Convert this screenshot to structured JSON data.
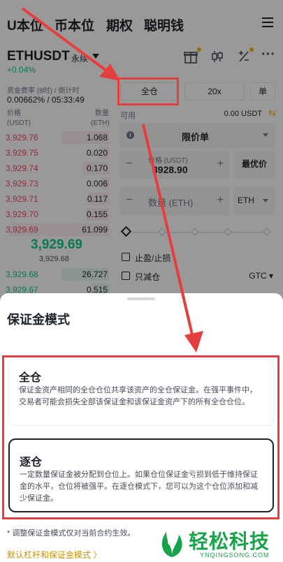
{
  "nav": {
    "tabs": [
      "U本位",
      "币本位",
      "期权",
      "聪明钱"
    ]
  },
  "header": {
    "symbol": "ETHUSDT",
    "type_tag": "永续",
    "change": "+0.04%",
    "funding_label": "资金费率 (8时) / 倒计时",
    "funding_value": "0.00662% / 05:33:49"
  },
  "orderbook": {
    "price_label": "价格",
    "price_unit": "(USDT)",
    "qty_label": "数量",
    "qty_unit": "(ETH)",
    "asks": [
      {
        "price": "3,929.76",
        "qty": "1.068",
        "depth": 0.45
      },
      {
        "price": "3,929.75",
        "qty": "0.020",
        "depth": 0.1
      },
      {
        "price": "3,929.74",
        "qty": "0.170",
        "depth": 0.25
      },
      {
        "price": "3,929.73",
        "qty": "0.006",
        "depth": 0.08
      },
      {
        "price": "3,929.71",
        "qty": "0.117",
        "depth": 0.2
      },
      {
        "price": "3,929.70",
        "qty": "0.155",
        "depth": 0.22
      },
      {
        "price": "3,929.69",
        "qty": "61.099",
        "depth": 0.95
      }
    ],
    "last_price": "3,929.69",
    "mark_price": "3,929.68",
    "bids": [
      {
        "price": "3,929.68",
        "qty": "26.727",
        "depth": 0.45
      },
      {
        "price": "3,929.67",
        "qty": "0.515",
        "depth": 0.15
      }
    ]
  },
  "order_form": {
    "margin_mode": "全仓",
    "leverage": "20x",
    "single_button": "单",
    "available_label": "可用",
    "available_value": "0.00 USDT",
    "order_type": "限价单",
    "price_label": "价格 (USDT)",
    "price_value": "3928.90",
    "best_price": "最优价",
    "qty_placeholder": "数量 (ETH)",
    "qty_unit": "ETH",
    "tp_sl": "止盈/止损",
    "reduce_only": "只减仓",
    "tif": "GTC"
  },
  "sheet": {
    "title": "保证金模式",
    "cross": {
      "title": "全仓",
      "desc": "保证金资产相同的全仓仓位共享该资产的全仓保证金。在强平事件中，交易者可能会损失全部该保证金和该保证金资产下的所有全仓仓位。"
    },
    "isolated": {
      "title": "逐仓",
      "desc": "一定数量保证金被分配到仓位上。如果仓位保证金亏损到低于维持保证金的水平，仓位将被强平。在逐仓模式下，您可以为这个仓位添加和减少保证金。"
    },
    "note": "* 调整保证金模式仅对当前合约生效。",
    "link": "默认杠杆和保证金模式 〉"
  },
  "watermark": {
    "text": "轻松科技",
    "sub": "YNQINGSONG.COM"
  },
  "colors": {
    "accent": "#f0b90b",
    "up": "#0ecb81",
    "down": "#f6465d",
    "annotation": "#e53e3e",
    "watermark": "#17a34a"
  }
}
